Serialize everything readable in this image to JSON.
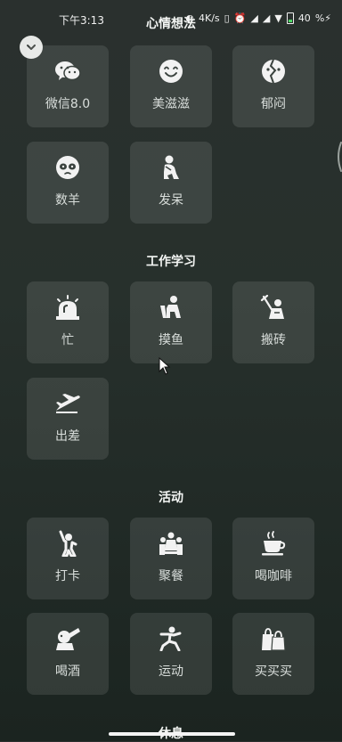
{
  "status_bar": {
    "time": "下午3:13",
    "network_speed": "4K/s",
    "battery_percent": "40"
  },
  "sections": [
    {
      "title": "心情想法",
      "items": [
        {
          "label": "微信8.0",
          "icon": "wechat-icon"
        },
        {
          "label": "美滋滋",
          "icon": "smile-face-icon"
        },
        {
          "label": "郁闷",
          "icon": "gloomy-face-icon"
        },
        {
          "label": "数羊",
          "icon": "sheep-icon"
        },
        {
          "label": "发呆",
          "icon": "daydream-figure-icon"
        }
      ]
    },
    {
      "title": "工作学习",
      "items": [
        {
          "label": "忙",
          "icon": "alarm-siren-icon"
        },
        {
          "label": "摸鱼",
          "icon": "slacking-figure-icon"
        },
        {
          "label": "搬砖",
          "icon": "brick-worker-icon"
        },
        {
          "label": "出差",
          "icon": "airplane-icon"
        }
      ]
    },
    {
      "title": "活动",
      "items": [
        {
          "label": "打卡",
          "icon": "check-in-figure-icon"
        },
        {
          "label": "聚餐",
          "icon": "dinner-gathering-icon"
        },
        {
          "label": "喝咖啡",
          "icon": "coffee-cup-icon"
        },
        {
          "label": "喝酒",
          "icon": "drinking-figure-icon"
        },
        {
          "label": "运动",
          "icon": "running-figure-icon"
        },
        {
          "label": "买买买",
          "icon": "shopping-bag-icon"
        }
      ]
    },
    {
      "title": "休息",
      "items": []
    }
  ]
}
